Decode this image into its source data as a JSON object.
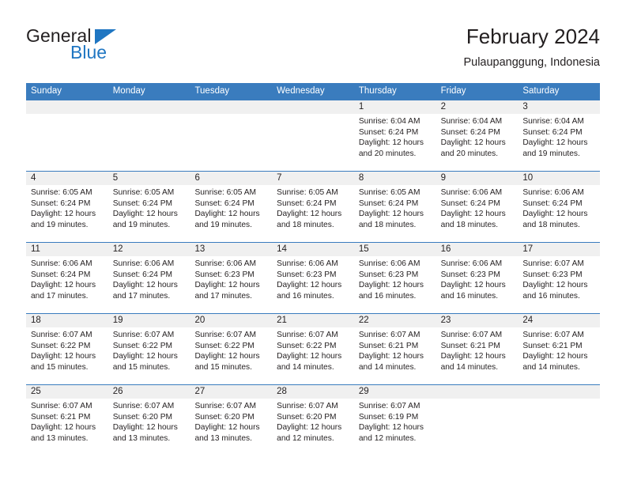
{
  "brand": {
    "word1": "General",
    "word2": "Blue",
    "triangle_color": "#1f76c2",
    "logo_icon": "general-blue-triangle-icon"
  },
  "header": {
    "title": "February 2024",
    "subtitle": "Pulaupanggung, Indonesia"
  },
  "theme": {
    "header_blue": "#3a7cbe",
    "band_gray": "#f0f0f0",
    "text": "#231f20"
  },
  "calendar": {
    "weekdays": [
      "Sunday",
      "Monday",
      "Tuesday",
      "Wednesday",
      "Thursday",
      "Friday",
      "Saturday"
    ],
    "weeks": [
      [
        {
          "day": "",
          "empty": true
        },
        {
          "day": "",
          "empty": true
        },
        {
          "day": "",
          "empty": true
        },
        {
          "day": "",
          "empty": true
        },
        {
          "day": "1",
          "sunrise": "Sunrise: 6:04 AM",
          "sunset": "Sunset: 6:24 PM",
          "daylight1": "Daylight: 12 hours",
          "daylight2": "and 20 minutes."
        },
        {
          "day": "2",
          "sunrise": "Sunrise: 6:04 AM",
          "sunset": "Sunset: 6:24 PM",
          "daylight1": "Daylight: 12 hours",
          "daylight2": "and 20 minutes."
        },
        {
          "day": "3",
          "sunrise": "Sunrise: 6:04 AM",
          "sunset": "Sunset: 6:24 PM",
          "daylight1": "Daylight: 12 hours",
          "daylight2": "and 19 minutes."
        }
      ],
      [
        {
          "day": "4",
          "sunrise": "Sunrise: 6:05 AM",
          "sunset": "Sunset: 6:24 PM",
          "daylight1": "Daylight: 12 hours",
          "daylight2": "and 19 minutes."
        },
        {
          "day": "5",
          "sunrise": "Sunrise: 6:05 AM",
          "sunset": "Sunset: 6:24 PM",
          "daylight1": "Daylight: 12 hours",
          "daylight2": "and 19 minutes."
        },
        {
          "day": "6",
          "sunrise": "Sunrise: 6:05 AM",
          "sunset": "Sunset: 6:24 PM",
          "daylight1": "Daylight: 12 hours",
          "daylight2": "and 19 minutes."
        },
        {
          "day": "7",
          "sunrise": "Sunrise: 6:05 AM",
          "sunset": "Sunset: 6:24 PM",
          "daylight1": "Daylight: 12 hours",
          "daylight2": "and 18 minutes."
        },
        {
          "day": "8",
          "sunrise": "Sunrise: 6:05 AM",
          "sunset": "Sunset: 6:24 PM",
          "daylight1": "Daylight: 12 hours",
          "daylight2": "and 18 minutes."
        },
        {
          "day": "9",
          "sunrise": "Sunrise: 6:06 AM",
          "sunset": "Sunset: 6:24 PM",
          "daylight1": "Daylight: 12 hours",
          "daylight2": "and 18 minutes."
        },
        {
          "day": "10",
          "sunrise": "Sunrise: 6:06 AM",
          "sunset": "Sunset: 6:24 PM",
          "daylight1": "Daylight: 12 hours",
          "daylight2": "and 18 minutes."
        }
      ],
      [
        {
          "day": "11",
          "sunrise": "Sunrise: 6:06 AM",
          "sunset": "Sunset: 6:24 PM",
          "daylight1": "Daylight: 12 hours",
          "daylight2": "and 17 minutes."
        },
        {
          "day": "12",
          "sunrise": "Sunrise: 6:06 AM",
          "sunset": "Sunset: 6:24 PM",
          "daylight1": "Daylight: 12 hours",
          "daylight2": "and 17 minutes."
        },
        {
          "day": "13",
          "sunrise": "Sunrise: 6:06 AM",
          "sunset": "Sunset: 6:23 PM",
          "daylight1": "Daylight: 12 hours",
          "daylight2": "and 17 minutes."
        },
        {
          "day": "14",
          "sunrise": "Sunrise: 6:06 AM",
          "sunset": "Sunset: 6:23 PM",
          "daylight1": "Daylight: 12 hours",
          "daylight2": "and 16 minutes."
        },
        {
          "day": "15",
          "sunrise": "Sunrise: 6:06 AM",
          "sunset": "Sunset: 6:23 PM",
          "daylight1": "Daylight: 12 hours",
          "daylight2": "and 16 minutes."
        },
        {
          "day": "16",
          "sunrise": "Sunrise: 6:06 AM",
          "sunset": "Sunset: 6:23 PM",
          "daylight1": "Daylight: 12 hours",
          "daylight2": "and 16 minutes."
        },
        {
          "day": "17",
          "sunrise": "Sunrise: 6:07 AM",
          "sunset": "Sunset: 6:23 PM",
          "daylight1": "Daylight: 12 hours",
          "daylight2": "and 16 minutes."
        }
      ],
      [
        {
          "day": "18",
          "sunrise": "Sunrise: 6:07 AM",
          "sunset": "Sunset: 6:22 PM",
          "daylight1": "Daylight: 12 hours",
          "daylight2": "and 15 minutes."
        },
        {
          "day": "19",
          "sunrise": "Sunrise: 6:07 AM",
          "sunset": "Sunset: 6:22 PM",
          "daylight1": "Daylight: 12 hours",
          "daylight2": "and 15 minutes."
        },
        {
          "day": "20",
          "sunrise": "Sunrise: 6:07 AM",
          "sunset": "Sunset: 6:22 PM",
          "daylight1": "Daylight: 12 hours",
          "daylight2": "and 15 minutes."
        },
        {
          "day": "21",
          "sunrise": "Sunrise: 6:07 AM",
          "sunset": "Sunset: 6:22 PM",
          "daylight1": "Daylight: 12 hours",
          "daylight2": "and 14 minutes."
        },
        {
          "day": "22",
          "sunrise": "Sunrise: 6:07 AM",
          "sunset": "Sunset: 6:21 PM",
          "daylight1": "Daylight: 12 hours",
          "daylight2": "and 14 minutes."
        },
        {
          "day": "23",
          "sunrise": "Sunrise: 6:07 AM",
          "sunset": "Sunset: 6:21 PM",
          "daylight1": "Daylight: 12 hours",
          "daylight2": "and 14 minutes."
        },
        {
          "day": "24",
          "sunrise": "Sunrise: 6:07 AM",
          "sunset": "Sunset: 6:21 PM",
          "daylight1": "Daylight: 12 hours",
          "daylight2": "and 14 minutes."
        }
      ],
      [
        {
          "day": "25",
          "sunrise": "Sunrise: 6:07 AM",
          "sunset": "Sunset: 6:21 PM",
          "daylight1": "Daylight: 12 hours",
          "daylight2": "and 13 minutes."
        },
        {
          "day": "26",
          "sunrise": "Sunrise: 6:07 AM",
          "sunset": "Sunset: 6:20 PM",
          "daylight1": "Daylight: 12 hours",
          "daylight2": "and 13 minutes."
        },
        {
          "day": "27",
          "sunrise": "Sunrise: 6:07 AM",
          "sunset": "Sunset: 6:20 PM",
          "daylight1": "Daylight: 12 hours",
          "daylight2": "and 13 minutes."
        },
        {
          "day": "28",
          "sunrise": "Sunrise: 6:07 AM",
          "sunset": "Sunset: 6:20 PM",
          "daylight1": "Daylight: 12 hours",
          "daylight2": "and 12 minutes."
        },
        {
          "day": "29",
          "sunrise": "Sunrise: 6:07 AM",
          "sunset": "Sunset: 6:19 PM",
          "daylight1": "Daylight: 12 hours",
          "daylight2": "and 12 minutes."
        },
        {
          "day": "",
          "empty": true
        },
        {
          "day": "",
          "empty": true
        }
      ]
    ]
  }
}
